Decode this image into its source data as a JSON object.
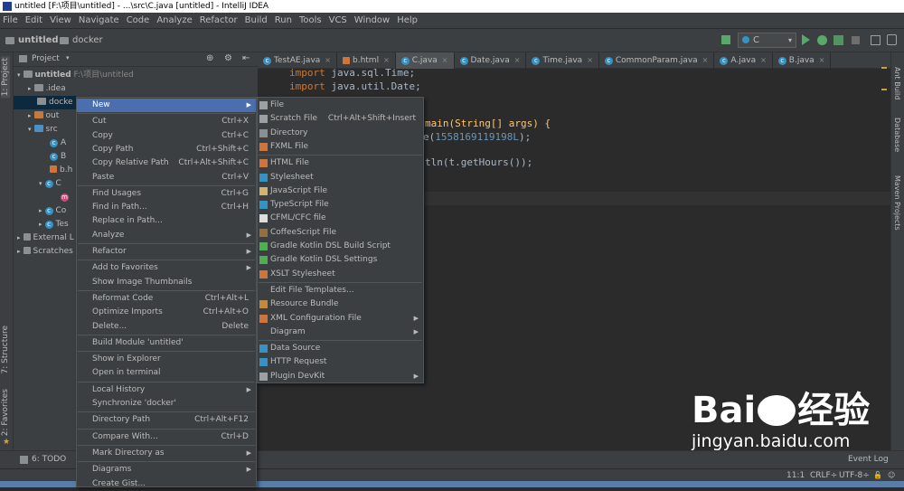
{
  "window": {
    "title": "untitled [F:\\项目\\untitled] - ...\\src\\C.java [untitled] - IntelliJ IDEA"
  },
  "menubar": [
    "File",
    "Edit",
    "View",
    "Navigate",
    "Code",
    "Analyze",
    "Refactor",
    "Build",
    "Run",
    "Tools",
    "VCS",
    "Window",
    "Help"
  ],
  "breadcrumb": {
    "project": "untitled",
    "folder": "docker"
  },
  "run_config": "C",
  "left_tabs": {
    "project": "1: Project",
    "structure": "7: Structure",
    "favorites": "2: Favorites"
  },
  "right_tabs": {
    "ant": "Ant Build",
    "database": "Database",
    "maven": "Maven Projects"
  },
  "project_panel": {
    "header": "Project",
    "tree": [
      {
        "label": "untitled",
        "extra": "F:\\项目\\untitled"
      },
      {
        "label": ".idea"
      },
      {
        "label": "docke"
      },
      {
        "label": "out"
      },
      {
        "label": "src"
      },
      {
        "label": "A"
      },
      {
        "label": "B"
      },
      {
        "label": "b.h"
      },
      {
        "label": "C"
      },
      {
        "label": ""
      },
      {
        "label": "Co"
      },
      {
        "label": "Tes"
      },
      {
        "label": "External L"
      },
      {
        "label": "Scratches"
      }
    ]
  },
  "editor_tabs": [
    "TestAE.java",
    "b.html",
    "C.java",
    "Date.java",
    "Time.java",
    "CommonParam.java",
    "A.java",
    "B.java"
  ],
  "code": {
    "line1_kw": "import",
    "line1_rest": " java.sql.Time;",
    "line2_kw": "import",
    "line2_rest": " java.util.Date;",
    "line3": "main(String[] args) {",
    "line4_pre": "e(",
    "line4_num": "1558169119198L",
    "line4_post": ");",
    "line5": "tln(t.getHours());"
  },
  "context_menu": [
    {
      "label": "New",
      "shortcut": "",
      "arrow": true,
      "selected": true
    },
    {
      "sep": true
    },
    {
      "label": "Cut",
      "shortcut": "Ctrl+X"
    },
    {
      "label": "Copy",
      "shortcut": "Ctrl+C"
    },
    {
      "label": "Copy Path",
      "shortcut": "Ctrl+Shift+C"
    },
    {
      "label": "Copy Relative Path",
      "shortcut": "Ctrl+Alt+Shift+C"
    },
    {
      "label": "Paste",
      "shortcut": "Ctrl+V"
    },
    {
      "sep": true
    },
    {
      "label": "Find Usages",
      "shortcut": "Ctrl+G"
    },
    {
      "label": "Find in Path...",
      "shortcut": "Ctrl+H"
    },
    {
      "label": "Replace in Path...",
      "shortcut": ""
    },
    {
      "label": "Analyze",
      "shortcut": "",
      "arrow": true
    },
    {
      "sep": true
    },
    {
      "label": "Refactor",
      "shortcut": "",
      "arrow": true
    },
    {
      "sep": true
    },
    {
      "label": "Add to Favorites",
      "shortcut": "",
      "arrow": true
    },
    {
      "label": "Show Image Thumbnails",
      "shortcut": ""
    },
    {
      "sep": true
    },
    {
      "label": "Reformat Code",
      "shortcut": "Ctrl+Alt+L"
    },
    {
      "label": "Optimize Imports",
      "shortcut": "Ctrl+Alt+O"
    },
    {
      "label": "Delete...",
      "shortcut": "Delete"
    },
    {
      "sep": true
    },
    {
      "label": "Build Module 'untitled'",
      "shortcut": ""
    },
    {
      "sep": true
    },
    {
      "label": "Show in Explorer",
      "shortcut": ""
    },
    {
      "label": "Open in terminal",
      "shortcut": ""
    },
    {
      "sep": true
    },
    {
      "label": "Local History",
      "shortcut": "",
      "arrow": true
    },
    {
      "label": "Synchronize 'docker'",
      "shortcut": ""
    },
    {
      "sep": true
    },
    {
      "label": "Directory Path",
      "shortcut": "Ctrl+Alt+F12"
    },
    {
      "sep": true
    },
    {
      "label": "Compare With...",
      "shortcut": "Ctrl+D"
    },
    {
      "sep": true
    },
    {
      "label": "Mark Directory as",
      "shortcut": "",
      "arrow": true
    },
    {
      "sep": true
    },
    {
      "label": "Diagrams",
      "shortcut": "",
      "arrow": true
    },
    {
      "label": "Create Gist...",
      "shortcut": ""
    }
  ],
  "new_submenu": [
    {
      "label": "File",
      "shortcut": "",
      "icon": "#9aa0a4"
    },
    {
      "label": "Scratch File",
      "shortcut": "Ctrl+Alt+Shift+Insert",
      "icon": "#9aa0a4"
    },
    {
      "label": "Directory",
      "shortcut": "",
      "icon": "#8a8f92"
    },
    {
      "label": "FXML File",
      "shortcut": "",
      "icon": "#d0743c"
    },
    {
      "sep": true
    },
    {
      "label": "HTML File",
      "shortcut": "",
      "icon": "#d0743c"
    },
    {
      "label": "Stylesheet",
      "shortcut": "",
      "icon": "#3592c4"
    },
    {
      "label": "JavaScript File",
      "shortcut": "",
      "icon": "#d5b36a"
    },
    {
      "label": "TypeScript File",
      "shortcut": "",
      "icon": "#3592c4"
    },
    {
      "label": "CFML/CFC file",
      "shortcut": "",
      "icon": "#dddddd"
    },
    {
      "label": "CoffeeScript File",
      "shortcut": "",
      "icon": "#9a6e3a"
    },
    {
      "label": "Gradle Kotlin DSL Build Script",
      "shortcut": "",
      "icon": "#4caf50"
    },
    {
      "label": "Gradle Kotlin DSL Settings",
      "shortcut": "",
      "icon": "#4caf50"
    },
    {
      "label": "XSLT Stylesheet",
      "shortcut": "",
      "icon": "#d0743c"
    },
    {
      "sep": true
    },
    {
      "label": "Edit File Templates...",
      "shortcut": "",
      "icon": ""
    },
    {
      "label": "Resource Bundle",
      "shortcut": "",
      "icon": "#c48a3c"
    },
    {
      "label": "XML Configuration File",
      "shortcut": "",
      "icon": "#d0743c",
      "arrow": true
    },
    {
      "label": "Diagram",
      "shortcut": "",
      "icon": "",
      "arrow": true
    },
    {
      "sep": true
    },
    {
      "label": "Data Source",
      "shortcut": "",
      "icon": "#3592c4"
    },
    {
      "label": "HTTP Request",
      "shortcut": "",
      "icon": "#3592c4"
    },
    {
      "label": "Plugin DevKit",
      "shortcut": "",
      "icon": "#9aa0a4",
      "arrow": true
    }
  ],
  "bottom": {
    "todo": "6: TODO",
    "event_log": "Event Log"
  },
  "status": {
    "position": "11:1",
    "line_sep": "CRLF÷",
    "encoding": "UTF-8÷"
  },
  "watermark": {
    "brand_a": "Bai",
    "brand_b": "经验",
    "url": "jingyan.baidu.com"
  }
}
